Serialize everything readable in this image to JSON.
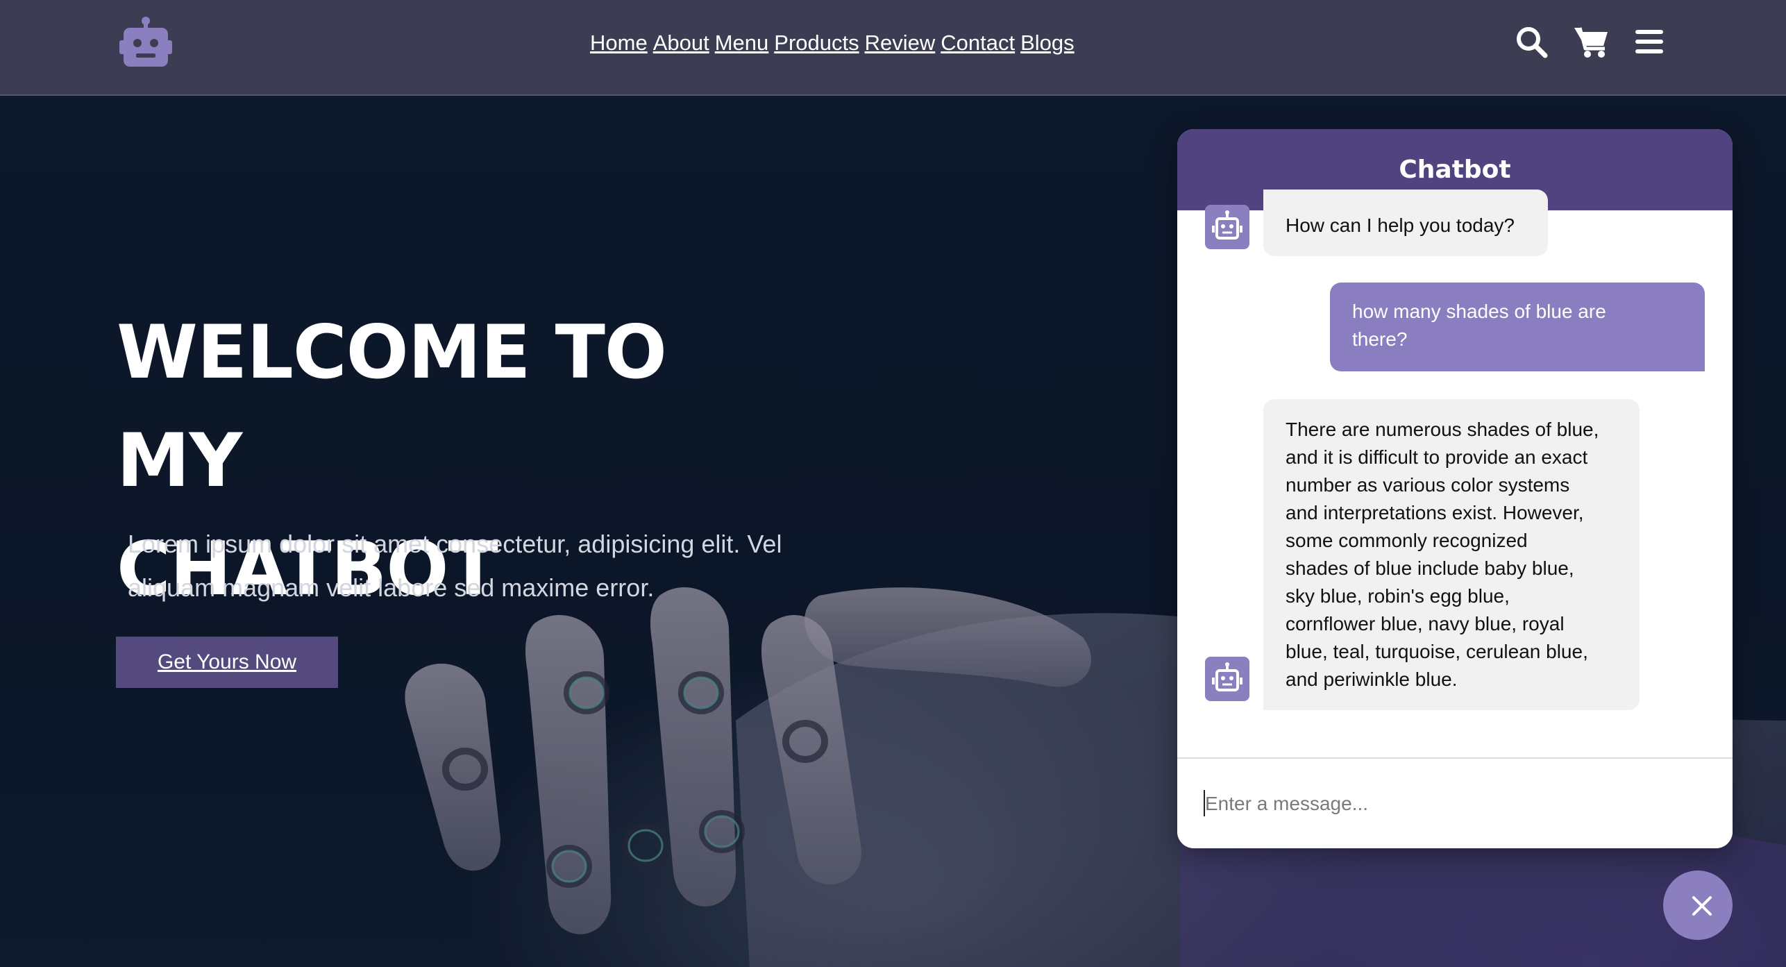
{
  "nav": {
    "links": [
      "Home",
      "About",
      "Menu",
      "Products",
      "Review",
      "Contact",
      "Blogs"
    ],
    "icons": [
      "search-icon",
      "cart-icon",
      "menu-icon"
    ]
  },
  "logo": {
    "icon": "robot-icon"
  },
  "hero": {
    "title_line1": "WELCOME TO MY",
    "title_line2": "CHATBOT",
    "subtitle_line1": "Lorem ipsum dolor sit amet consectetur, adipisicing elit. Vel",
    "subtitle_line2": "aliquam magnam velit labore sed maxime error.",
    "cta_label": "Get Yours Now"
  },
  "chatbot": {
    "title": "Chatbot",
    "messages": [
      {
        "role": "bot",
        "text": "How can I help you today?"
      },
      {
        "role": "user",
        "lines": [
          "how many shades of blue are",
          "there?"
        ]
      },
      {
        "role": "bot",
        "lines": [
          "There are numerous shades of blue,",
          "and it is difficult to provide an exact",
          "number as various color systems",
          "and interpretations exist. However,",
          "some commonly recognized",
          "shades of blue include baby blue,",
          "sky blue, robin's egg blue,",
          "cornflower blue, navy blue, royal",
          "blue, teal, turquoise, cerulean blue,",
          "and periwinkle blue."
        ]
      }
    ],
    "input_placeholder": "Enter a message...",
    "close_icon": "close-icon"
  },
  "colors": {
    "navbar": "#3c3d52",
    "accent_dark": "#504380",
    "accent_light": "#8b7fc0",
    "cta": "#544a7d",
    "bot_bubble": "#f1f1f2"
  }
}
